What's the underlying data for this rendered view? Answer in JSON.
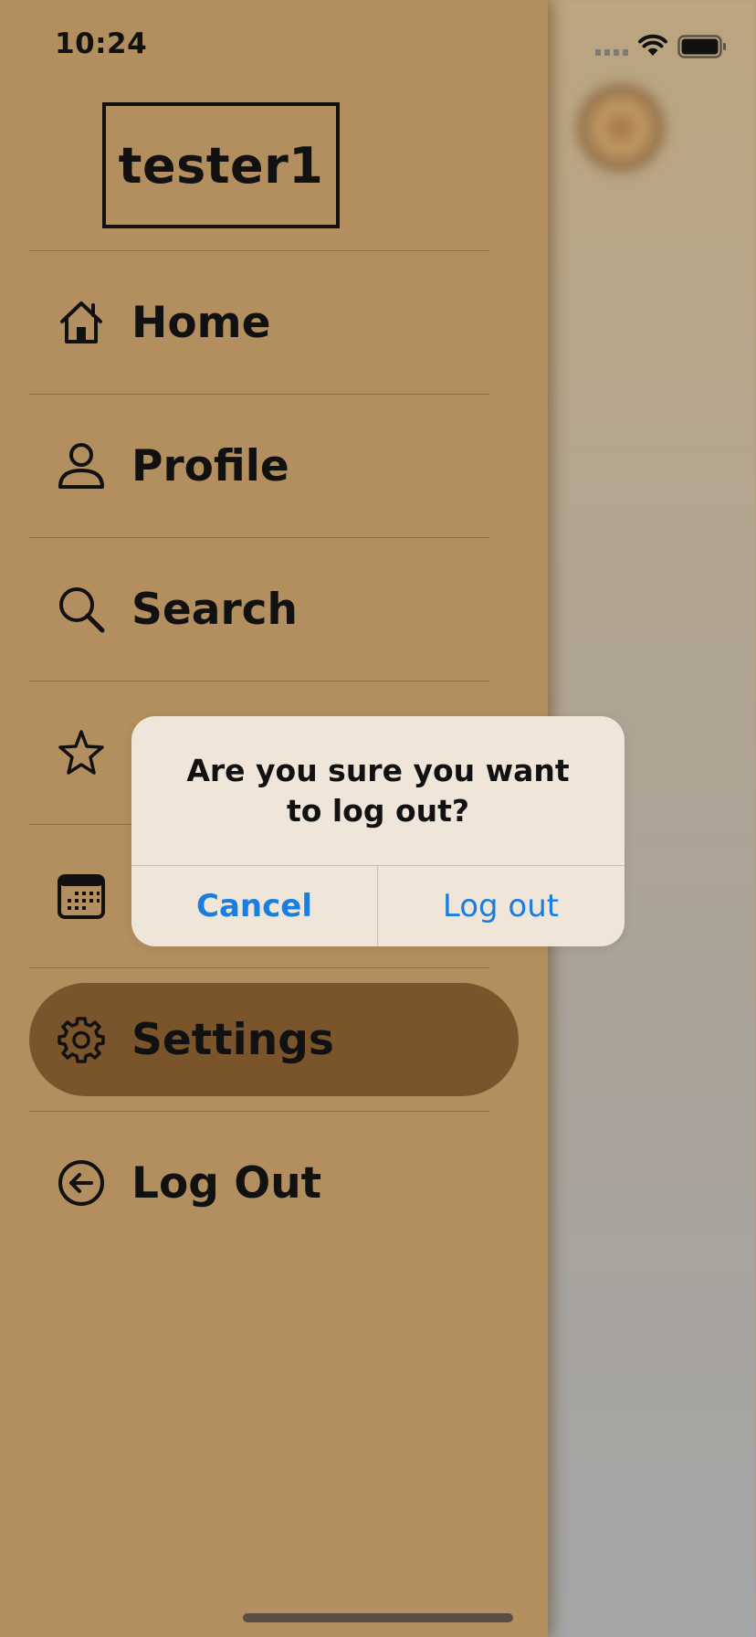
{
  "status_bar": {
    "time": "10:24"
  },
  "user": {
    "username": "tester1"
  },
  "menu": {
    "items": [
      {
        "label": "Home",
        "icon": "home-icon"
      },
      {
        "label": "Profile",
        "icon": "person-icon"
      },
      {
        "label": "Search",
        "icon": "search-icon"
      },
      {
        "label": "",
        "icon": "star-icon"
      },
      {
        "label": "",
        "icon": "calendar-icon"
      },
      {
        "label": "Settings",
        "icon": "gear-icon",
        "active": true
      },
      {
        "label": "Log Out",
        "icon": "arrow-left-circle-icon"
      }
    ]
  },
  "alert": {
    "message": "Are you sure you want to log out?",
    "cancel_label": "Cancel",
    "confirm_label": "Log out"
  },
  "colors": {
    "drawer_bg": "#b38e5e",
    "active_item_bg": "#7a542b",
    "alert_bg": "#efe5d9",
    "alert_button_text": "#1a7de0"
  }
}
